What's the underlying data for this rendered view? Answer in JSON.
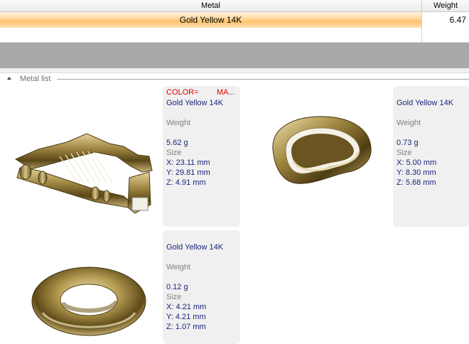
{
  "grid": {
    "headers": {
      "metal": "Metal",
      "weight": "Weight"
    },
    "rows": [
      {
        "metal": "Gold Yellow 14K",
        "weight": "6.47"
      }
    ]
  },
  "metal_list": {
    "title": "Metal list",
    "cards": [
      {
        "header_color_label": "COLOR=",
        "header_material_label": "MA...",
        "metal": "Gold Yellow 14K",
        "weight_label": "Weight",
        "weight": "5.62 g",
        "size_label": "Size",
        "x": "X: 23.11 mm",
        "y": "Y: 29.81 mm",
        "z": "Z: 4.91 mm",
        "preview": "harp-pendant"
      },
      {
        "metal": "Gold Yellow 14K",
        "weight_label": "Weight",
        "weight": "0.73 g",
        "size_label": "Size",
        "x": "X: 5.00 mm",
        "y": "Y: 8.30 mm",
        "z": "Z: 5.68 mm",
        "preview": "ring"
      },
      {
        "metal": "Gold Yellow 14K",
        "weight_label": "Weight",
        "weight": "0.12 g",
        "size_label": "Size",
        "x": "X: 4.21 mm",
        "y": "Y: 4.21 mm",
        "z": "Z: 1.07 mm",
        "preview": "torus-bead"
      }
    ]
  },
  "colors": {
    "selection": "#ffc46e",
    "gray_band": "#a9a9a9",
    "info_text": "#1a237e",
    "header_red": "#e00000"
  }
}
